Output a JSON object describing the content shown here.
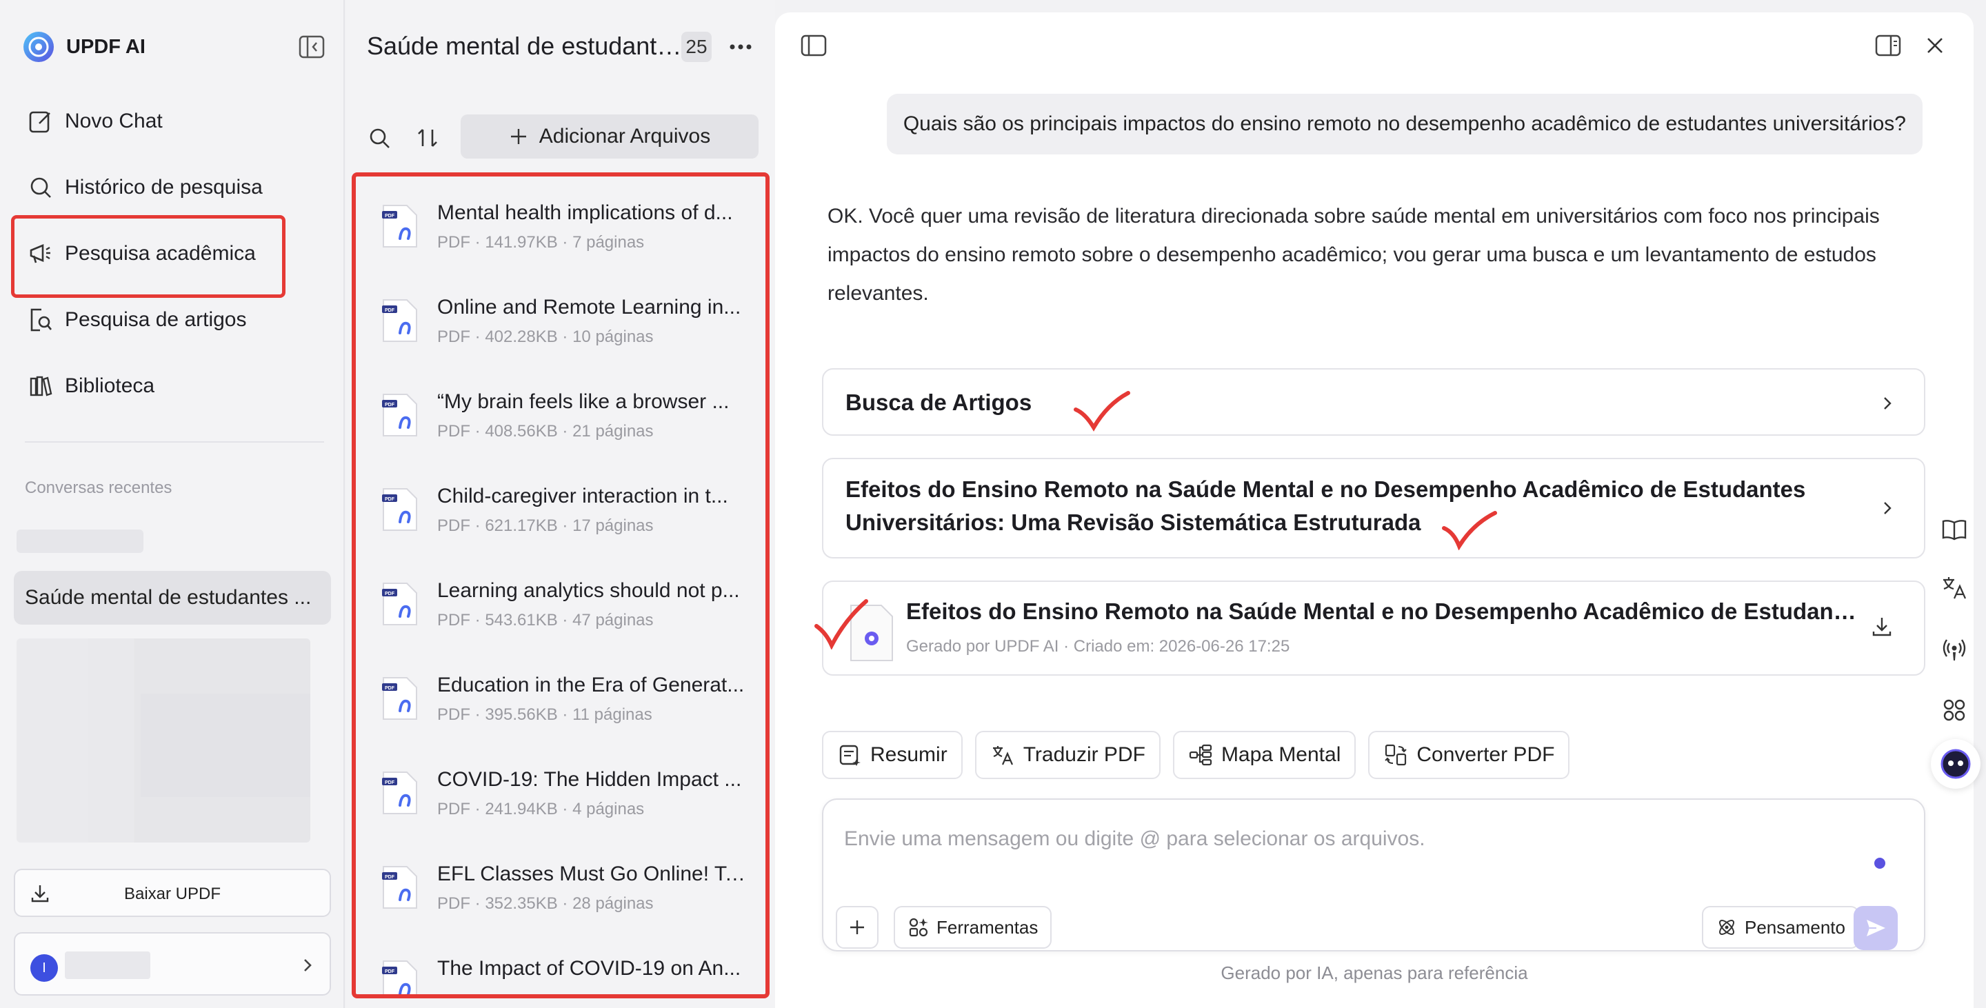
{
  "app": {
    "name": "UPDF AI"
  },
  "sidebar": {
    "nav": [
      {
        "label": "Novo Chat",
        "icon": "edit-icon"
      },
      {
        "label": "Histórico de pesquisa",
        "icon": "search-icon"
      },
      {
        "label": "Pesquisa acadêmica",
        "icon": "megaphone-icon"
      },
      {
        "label": "Pesquisa de artigos",
        "icon": "article-search-icon"
      },
      {
        "label": "Biblioteca",
        "icon": "library-icon"
      }
    ],
    "recent_title": "Conversas recentes",
    "recent_active": "Saúde mental de estudantes ...",
    "download_label": "Baixar UPDF",
    "user_initial": "I"
  },
  "files": {
    "title": "Saúde mental de estudante...",
    "count": "25",
    "add_label": "Adicionar Arquivos",
    "items": [
      {
        "name": "Mental health implications of d...",
        "meta": "PDF · 141.97KB · 7 páginas"
      },
      {
        "name": "Online and Remote Learning in...",
        "meta": "PDF · 402.28KB · 10 páginas"
      },
      {
        "name": " “My brain feels like a browser ...",
        "meta": "PDF · 408.56KB · 21 páginas"
      },
      {
        "name": "Child-caregiver interaction in t...",
        "meta": "PDF · 621.17KB · 17 páginas"
      },
      {
        "name": "Learning analytics should not p...",
        "meta": "PDF · 543.61KB · 47 páginas"
      },
      {
        "name": "Education in the Era of Generat...",
        "meta": "PDF · 395.56KB · 11 páginas"
      },
      {
        "name": "COVID-19: The Hidden Impact ...",
        "meta": "PDF · 241.94KB · 4 páginas"
      },
      {
        "name": "EFL Classes Must Go Online! Te...",
        "meta": "PDF · 352.35KB · 28 páginas"
      },
      {
        "name": "The Impact of COVID-19 on An...",
        "meta": ""
      }
    ]
  },
  "chat": {
    "user_message": "Quais são os principais impactos do ensino remoto no desempenho acadêmico de estudantes universitários?",
    "ai_message": "OK. Você quer uma revisão de literatura direcionada sobre saúde mental em universitários com foco nos principais impactos do ensino remoto sobre o desempenho acadêmico; vou gerar uma busca e um levantamento de estudos relevantes.",
    "card_search": "Busca de Artigos",
    "card_review_line1": "Efeitos do Ensino Remoto na Saúde Mental e no Desempenho Acadêmico de Estudantes",
    "card_review_line2": "Universitários: Uma Revisão Sistemática Estruturada",
    "doc_title": "Efeitos do Ensino Remoto na Saúde Mental e no Desempenho Acadêmico de Estudantes Universitários",
    "doc_sub": "Gerado por UPDF AI · Criado em: 2026-06-26 17:25",
    "actions": [
      "Resumir",
      "Traduzir PDF",
      "Mapa Mental",
      "Converter PDF"
    ],
    "composer_placeholder": "Envie uma mensagem ou digite @ para selecionar os arquivos.",
    "tools_label": "Ferramentas",
    "think_label": "Pensamento",
    "footer_note": "Gerado por IA, apenas para referência"
  },
  "colors": {
    "accent": "#5a52e0",
    "highlight": "#e53935",
    "send_disabled": "#c8c6f4"
  }
}
